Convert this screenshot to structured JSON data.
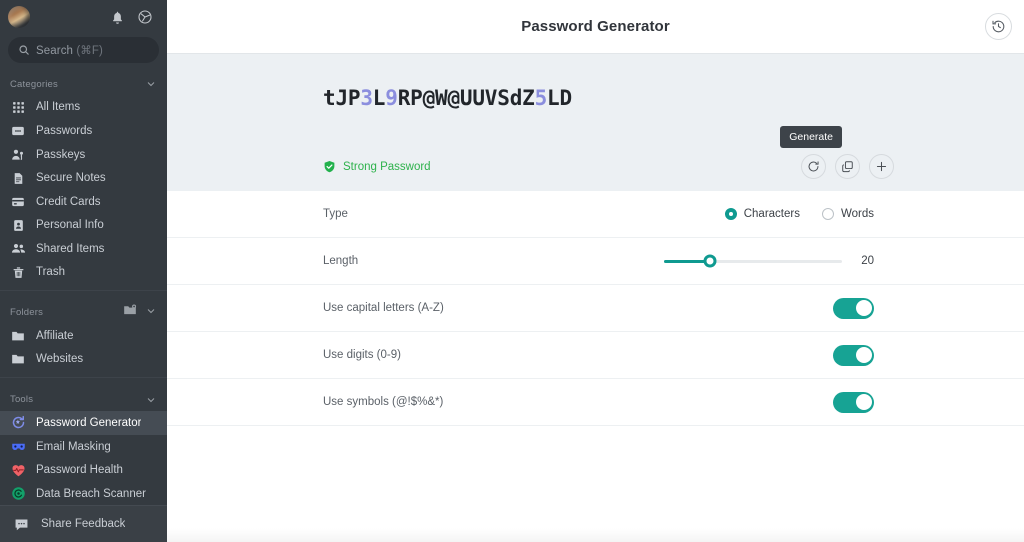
{
  "sidebar": {
    "top": {
      "avatar": "user-avatar",
      "bell_icon": "bell-icon",
      "settings_icon": "gear-icon"
    },
    "search": {
      "icon": "search-icon",
      "placeholder": "Search",
      "shortcut": "(⌘F)"
    },
    "sections": [
      {
        "title": "Categories",
        "collapse_icon": "chevron-down-icon",
        "items": [
          {
            "label": "All Items",
            "icon": "grid-icon"
          },
          {
            "label": "Passwords",
            "icon": "password-card-icon"
          },
          {
            "label": "Passkeys",
            "icon": "passkey-person-icon"
          },
          {
            "label": "Secure Notes",
            "icon": "document-icon"
          },
          {
            "label": "Credit Cards",
            "icon": "credit-card-icon"
          },
          {
            "label": "Personal Info",
            "icon": "id-card-icon"
          },
          {
            "label": "Shared Items",
            "icon": "people-icon"
          },
          {
            "label": "Trash",
            "icon": "trash-icon"
          }
        ]
      },
      {
        "title": "Folders",
        "add_icon": "add-folder-icon",
        "collapse_icon": "chevron-down-icon",
        "items": [
          {
            "label": "Affiliate",
            "icon": "folder-icon"
          },
          {
            "label": "Websites",
            "icon": "folder-icon"
          }
        ]
      },
      {
        "title": "Tools",
        "collapse_icon": "chevron-down-icon",
        "items": [
          {
            "label": "Password Generator",
            "icon": "password-generator-icon",
            "active": true
          },
          {
            "label": "Email Masking",
            "icon": "mask-icon"
          },
          {
            "label": "Password Health",
            "icon": "heart-pulse-icon"
          },
          {
            "label": "Data Breach Scanner",
            "icon": "breach-scanner-icon"
          }
        ]
      }
    ],
    "footer": {
      "label": "Share Feedback",
      "icon": "chat-icon"
    }
  },
  "header": {
    "title": "Password Generator",
    "history_icon": "history-clock-icon"
  },
  "password_panel": {
    "segments": [
      {
        "text": "tJP",
        "kind": "plain"
      },
      {
        "text": "3",
        "kind": "digit"
      },
      {
        "text": "L",
        "kind": "plain"
      },
      {
        "text": "9",
        "kind": "digit"
      },
      {
        "text": "RP@W@UUVSdZ",
        "kind": "plain"
      },
      {
        "text": "5",
        "kind": "digit"
      },
      {
        "text": "LD",
        "kind": "plain"
      }
    ],
    "password": "tJP3L9RP@W@UUVSdZ5LD",
    "strength_label": "Strong Password",
    "strength_icon": "shield-check-icon",
    "strength_color": "#2eb24c",
    "tooltip": "Generate",
    "buttons": [
      {
        "name": "regenerate",
        "icon": "refresh-icon"
      },
      {
        "name": "copy",
        "icon": "copy-icon"
      },
      {
        "name": "add",
        "icon": "plus-icon"
      }
    ]
  },
  "settings": {
    "type": {
      "label": "Type",
      "options": [
        {
          "label": "Characters",
          "selected": true
        },
        {
          "label": "Words",
          "selected": false
        }
      ]
    },
    "length": {
      "label": "Length",
      "value": "20",
      "percent": 26
    },
    "toggles": [
      {
        "label": "Use capital letters (A-Z)",
        "on": true
      },
      {
        "label": "Use digits (0-9)",
        "on": true
      },
      {
        "label": "Use symbols (@!$%&*)",
        "on": true
      }
    ]
  },
  "colors": {
    "accent": "#0f9a90",
    "toggle_on": "#17a394",
    "digit": "#8b8ede",
    "sidebar_bg": "#343a40",
    "panel_bg": "#ecf0f3"
  }
}
